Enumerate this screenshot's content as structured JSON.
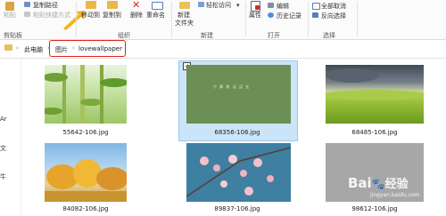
{
  "ribbon": {
    "clipboard": {
      "paste": "粘贴",
      "copy_path": "复制路径",
      "paste_shortcut": "粘贴快捷方式",
      "group": "剪贴板"
    },
    "organize": {
      "move_to": "移动到",
      "copy_to": "复制到",
      "delete": "删除",
      "rename": "重命名",
      "group": "组织"
    },
    "new": {
      "new_folder_l1": "新建",
      "new_folder_l2": "文件夹",
      "easy_access": "轻松访问",
      "easy_access_arrow": "▾",
      "group": "新建"
    },
    "open": {
      "properties": "属性",
      "edit": "编辑",
      "history": "历史记录",
      "group": "打开"
    },
    "select": {
      "select_all": "全部取消",
      "invert": "反向选择",
      "group": "选择"
    }
  },
  "address": {
    "this_pc": "此电脑",
    "pictures": "图片",
    "folder": "lovewallpaper",
    "separator": "›"
  },
  "leftpane": {
    "items": [
      "Ar",
      "文",
      "牛"
    ]
  },
  "files": [
    {
      "name": "55642-106.jpg",
      "selected": false,
      "icon": "bamboo-image"
    },
    {
      "name": "68356-106.jpg",
      "selected": true,
      "icon": "green-text-image"
    },
    {
      "name": "68485-106.jpg",
      "selected": false,
      "icon": "grassland-image"
    },
    {
      "name": "84082-106.jpg",
      "selected": false,
      "icon": "autumn-trees-image"
    },
    {
      "name": "89837-106.jpg",
      "selected": false,
      "icon": "blossom-image"
    },
    {
      "name": "98612-106.jpg",
      "selected": false,
      "icon": "gray-image"
    }
  ],
  "watermark": {
    "brand": "Bai",
    "brand2": "经验",
    "url": "jingyan.baidu.com"
  },
  "selected_tile_text": "宁 静 致 远 远 在",
  "colors": {
    "accent": "#cce4f7",
    "highlight": "#e0201e"
  }
}
